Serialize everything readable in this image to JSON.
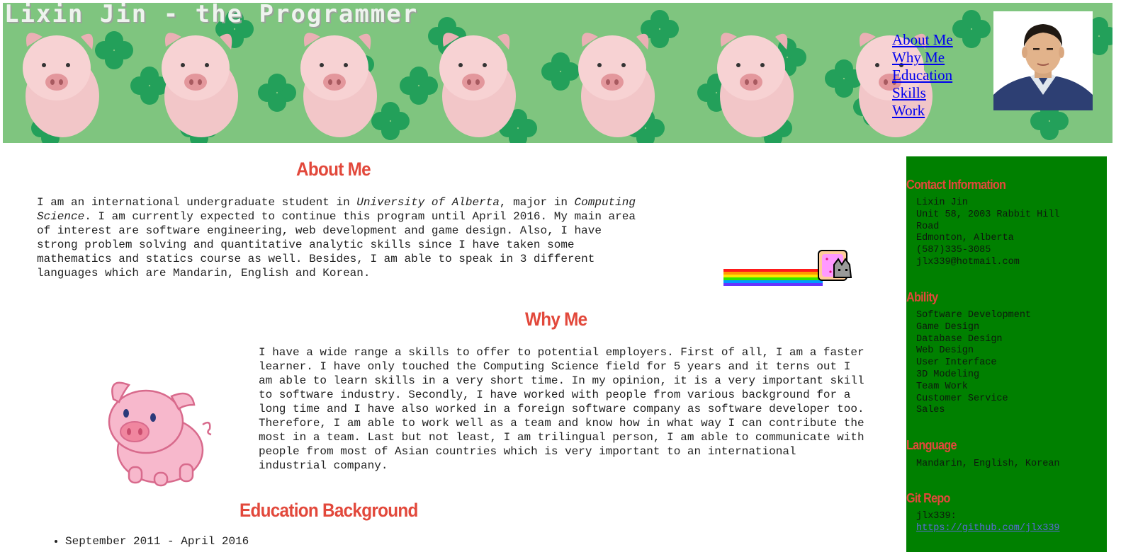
{
  "header": {
    "site_title": "Lixin Jin - the Programmer",
    "nav": [
      {
        "label": "About Me"
      },
      {
        "label": "Why Me"
      },
      {
        "label": "Education"
      },
      {
        "label": "Skills"
      },
      {
        "label": "Work"
      }
    ],
    "banner_color": "#7fc57f"
  },
  "about": {
    "title": "About Me",
    "p1": "I am an international undergraduate student in ",
    "university": "University of Alberta",
    "p2": ", major in ",
    "major": "Computing Science",
    "p3": ". I am currently expected to continue this program until April 2016. My main area of interest are software engineering, web development and game design. Also, I have strong problem solving and quantitative analytic skills since I have taken some mathematics and statics course as well. Besides, I am able to speak in 3 different languages which are Mandarin, English and Korean."
  },
  "why": {
    "title": "Why Me",
    "text": "I have a wide range a skills to offer to potential employers. First of all, I am a faster learner. I have only touched the Computing Science field for 5 years and it terns out I am able to learn skills in a very short time. In my opinion, it is a very important skill to software industry. Secondly, I have worked with people from various background for a long time and I have also worked in a foreign software company as software developer too. Therefore, I am able to work well as a team and know how in what way I can contribute the most in a team. Last but not least, I am trilingual person, I am able to communicate with people from most of Asian countries which is very important to an international industrial company."
  },
  "education": {
    "title": "Education Background",
    "items": [
      "September 2011 - April 2016"
    ]
  },
  "sidebar": {
    "bg_color": "#008000",
    "heading_color": "#e2483b",
    "contact": {
      "title": "Contact Information",
      "lines": [
        "Lixin Jin",
        "Unit 58, 2003 Rabbit Hill",
        "Road",
        "Edmonton, Alberta",
        "(587)335-3085",
        "jlx339@hotmail.com"
      ]
    },
    "ability": {
      "title": "Ability",
      "items": [
        "Software Development",
        "Game Design",
        "Database Design",
        "Web Design",
        "User Interface",
        "3D Modeling",
        "Team Work",
        "Customer Service",
        "Sales"
      ]
    },
    "language": {
      "title": "Language",
      "items": [
        "Mandarin, English, Korean"
      ]
    },
    "git": {
      "title": "Git Repo",
      "user": "jlx339:",
      "link": "https://github.com/jlx339"
    }
  }
}
